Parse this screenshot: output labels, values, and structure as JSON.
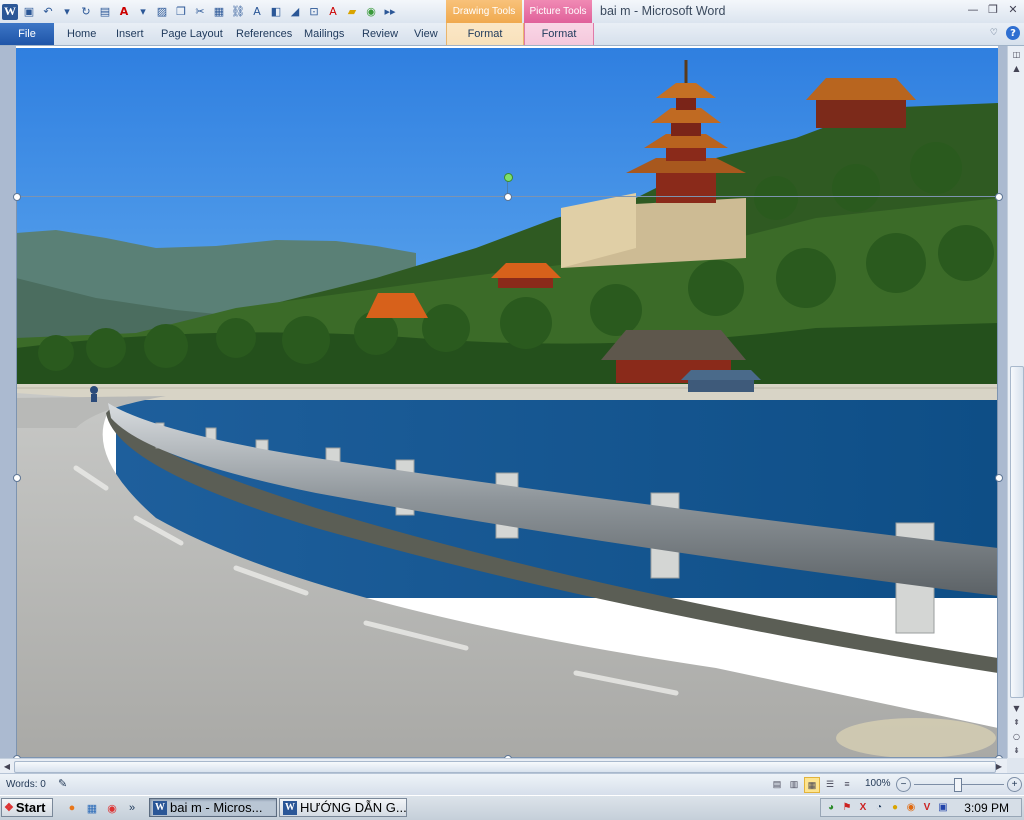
{
  "window": {
    "document_title": "bai m  -  Microsoft Word",
    "context_tools": [
      {
        "label": "Drawing Tools",
        "color": "#f0a94e"
      },
      {
        "label": "Picture Tools",
        "color": "#e0609a"
      }
    ]
  },
  "ribbon": {
    "tabs": [
      "File",
      "Home",
      "Insert",
      "Page Layout",
      "References",
      "Mailings",
      "Review",
      "View"
    ],
    "context_tabs": [
      "Format",
      "Format"
    ],
    "colors": {
      "file_tab": "#2b65b8",
      "ribbon_bg": "#dfe6ef"
    }
  },
  "status_bar": {
    "words": "Words: 0",
    "zoom": "100%",
    "zoom_level_percent": 100
  },
  "taskbar": {
    "start_label": "Start",
    "more_label": "»",
    "tasks": [
      {
        "label": "bai m - Micros...",
        "active": true
      },
      {
        "label": "HƯỚNG DẪN G...",
        "active": false
      }
    ],
    "clock": "3:09 PM"
  },
  "icons": {
    "qat": [
      "word-app-icon",
      "save-icon",
      "undo-icon",
      "redo-icon",
      "font-color-icon",
      "picture-icon",
      "cut-icon",
      "open-icon"
    ],
    "window_controls": [
      "minimize-icon",
      "restore-icon",
      "close-icon"
    ]
  },
  "image": {
    "description_kind": "photo",
    "selected": true
  }
}
